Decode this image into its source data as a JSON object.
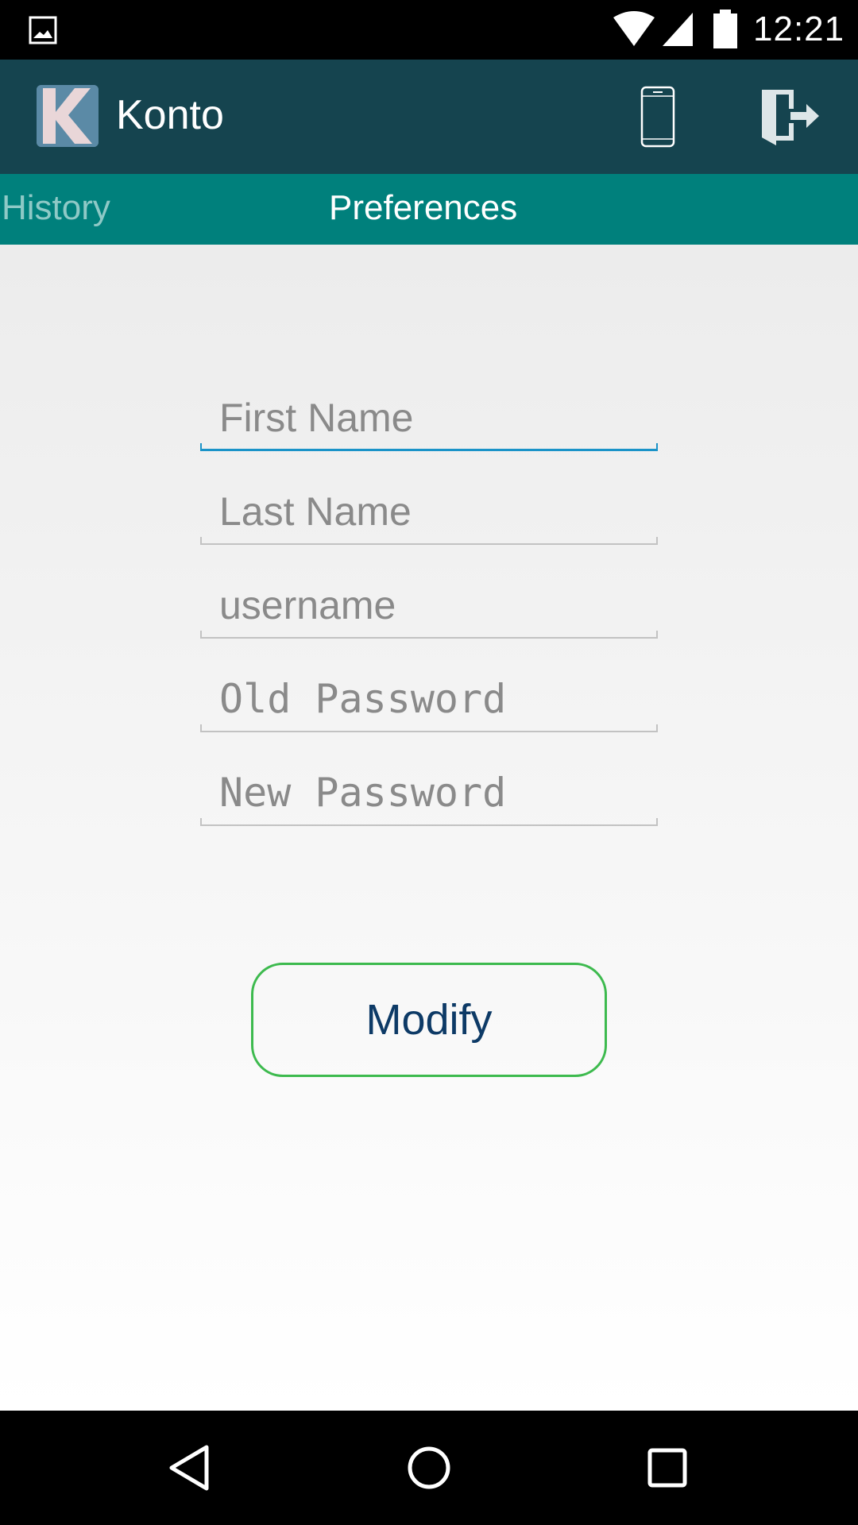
{
  "status_bar": {
    "time": "12:21",
    "icons": [
      "image-notification-icon",
      "wifi-icon",
      "cellular-signal-icon",
      "battery-icon"
    ]
  },
  "app_bar": {
    "logo_letter": "K",
    "title": "Konto",
    "actions": [
      "phone-icon",
      "logout-icon"
    ]
  },
  "tabs": [
    {
      "label": "History",
      "selected": false
    },
    {
      "label": "Preferences",
      "selected": true
    }
  ],
  "form": {
    "first_name": {
      "placeholder": "First Name",
      "value": ""
    },
    "last_name": {
      "placeholder": "Last Name",
      "value": ""
    },
    "username": {
      "placeholder": "username",
      "value": ""
    },
    "old_password": {
      "placeholder": "Old Password",
      "value": ""
    },
    "new_password": {
      "placeholder": "New Password",
      "value": ""
    },
    "submit_label": "Modify"
  },
  "nav_bar": {
    "buttons": [
      "back-icon",
      "home-icon",
      "recents-icon"
    ]
  },
  "colors": {
    "app_bar": "#15444f",
    "tab_bar": "#00807c",
    "focus_underline": "#1a93c8",
    "button_border": "#3dba4e",
    "button_text": "#0d3a66"
  }
}
